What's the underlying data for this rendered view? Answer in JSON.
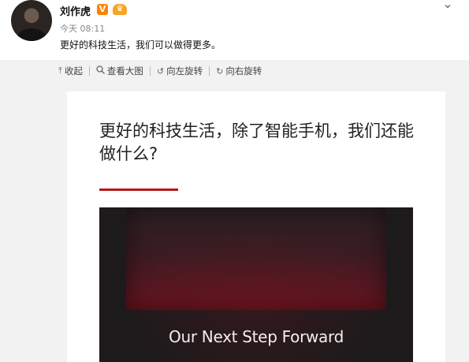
{
  "post": {
    "author": "刘作虎",
    "verified_badge": "V",
    "time": "今天 08:11",
    "text": "更好的科技生活，我们可以做得更多。",
    "more_icon": "chevron-down-icon"
  },
  "toolbar": {
    "collapse": "收起",
    "view_large": "查看大图",
    "rotate_left": "向左旋转",
    "rotate_right": "向右旋转"
  },
  "image": {
    "title": "更好的科技生活，除了智能手机，我们还能做什么?",
    "caption": "Our Next Step Forward"
  },
  "colors": {
    "accent_red": "#b3171b",
    "verified_orange": "#ff8200"
  }
}
